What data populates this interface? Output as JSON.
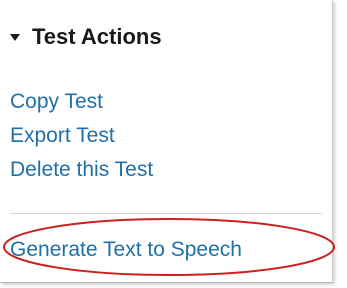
{
  "panel": {
    "title": "Test Actions",
    "links": [
      {
        "label": "Copy Test"
      },
      {
        "label": "Export Test"
      },
      {
        "label": "Delete this Test"
      }
    ],
    "highlighted_link": {
      "label": "Generate Text to Speech"
    }
  },
  "colors": {
    "link": "#1f70a8",
    "highlight": "#cc1f1f",
    "title": "#1a1a1a"
  },
  "icons": {
    "collapse": "caret-down-icon"
  }
}
